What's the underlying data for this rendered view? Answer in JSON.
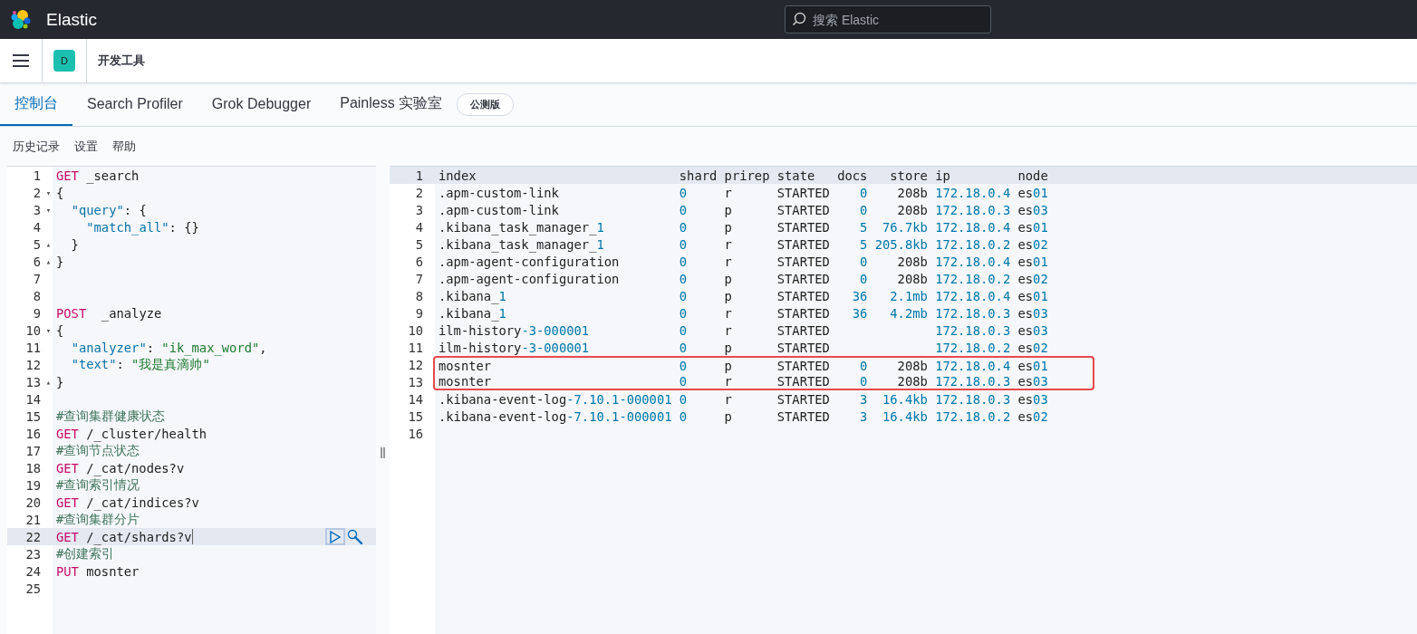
{
  "header": {
    "brand": "Elastic",
    "search": {
      "placeholder": "搜索 Elastic"
    }
  },
  "breadcrumb": {
    "space_initial": "D",
    "title": "开发工具"
  },
  "tabs": [
    {
      "label": "控制台",
      "selected": true
    },
    {
      "label": "Search Profiler",
      "selected": false
    },
    {
      "label": "Grok Debugger",
      "selected": false
    },
    {
      "label": "Painless 实验室",
      "selected": false,
      "badge": "公测版"
    }
  ],
  "menu": [
    "历史记录",
    "设置",
    "帮助"
  ],
  "editor": {
    "lines": [
      {
        "number": "1",
        "kind": "request",
        "text": "GET _search",
        "active": false
      },
      {
        "number": "2",
        "kind": "json",
        "text": "{",
        "fold_marker": "▾",
        "active": false
      },
      {
        "number": "3",
        "kind": "json",
        "text": "  \"query\": {",
        "fold_marker": "▾",
        "active": false
      },
      {
        "number": "4",
        "kind": "json",
        "text": "    \"match_all\": {}",
        "active": false
      },
      {
        "number": "5",
        "kind": "json",
        "text": "  }",
        "fold_marker": "▴",
        "active": false
      },
      {
        "number": "6",
        "kind": "json",
        "text": "}",
        "fold_marker": "▴",
        "active": false
      },
      {
        "number": "7",
        "kind": "blank",
        "active": false
      },
      {
        "number": "8",
        "kind": "blank",
        "active": false
      },
      {
        "number": "9",
        "kind": "request",
        "text": "POST  _analyze",
        "active": false
      },
      {
        "number": "10",
        "kind": "json",
        "text": "{",
        "fold_marker": "▾",
        "active": false
      },
      {
        "number": "11",
        "kind": "json",
        "text": "  \"analyzer\": \"ik_max_word\",",
        "active": false
      },
      {
        "number": "12",
        "kind": "json",
        "text": "  \"text\": \"我是真滴帅\"",
        "active": false
      },
      {
        "number": "13",
        "kind": "json",
        "text": "}",
        "fold_marker": "▴",
        "active": false
      },
      {
        "number": "14",
        "kind": "blank",
        "active": false
      },
      {
        "number": "15",
        "kind": "comment",
        "text": "#查询集群健康状态",
        "active": false
      },
      {
        "number": "16",
        "kind": "request",
        "text": "GET /_cluster/health",
        "active": false
      },
      {
        "number": "17",
        "kind": "comment",
        "text": "#查询节点状态",
        "active": false
      },
      {
        "number": "18",
        "kind": "request",
        "text": "GET /_cat/nodes?v",
        "active": false
      },
      {
        "number": "19",
        "kind": "comment",
        "text": "#查询索引情况",
        "active": false
      },
      {
        "number": "20",
        "kind": "request",
        "text": "GET /_cat/indices?v",
        "active": false
      },
      {
        "number": "21",
        "kind": "comment",
        "text": "#查询集群分片",
        "active": false
      },
      {
        "number": "22",
        "kind": "request",
        "text": "GET /_cat/shards?v",
        "active": true
      },
      {
        "number": "23",
        "kind": "comment",
        "text": "#创建索引",
        "active": false
      },
      {
        "number": "24",
        "kind": "request",
        "text": "PUT mosnter",
        "active": false
      },
      {
        "number": "25",
        "kind": "blank",
        "active": false
      }
    ]
  },
  "output": {
    "lines": [
      {
        "number": "1",
        "cells": [
          "index",
          "shard",
          "prirep",
          "state",
          "docs",
          "store",
          "ip",
          "node"
        ],
        "highlighted": false,
        "active": true
      },
      {
        "number": "2",
        "cells": [
          ".apm-custom-link",
          "0",
          "r",
          "STARTED",
          "0",
          "208b",
          "172.18.0.4",
          "es01"
        ],
        "highlighted": false,
        "active": false
      },
      {
        "number": "3",
        "cells": [
          ".apm-custom-link",
          "0",
          "p",
          "STARTED",
          "0",
          "208b",
          "172.18.0.3",
          "es03"
        ],
        "highlighted": false,
        "active": false
      },
      {
        "number": "4",
        "cells": [
          ".kibana_task_manager_1",
          "0",
          "p",
          "STARTED",
          "5",
          "76.7kb",
          "172.18.0.4",
          "es01"
        ],
        "highlighted": false,
        "active": false
      },
      {
        "number": "5",
        "cells": [
          ".kibana_task_manager_1",
          "0",
          "r",
          "STARTED",
          "5",
          "205.8kb",
          "172.18.0.2",
          "es02"
        ],
        "highlighted": false,
        "active": false
      },
      {
        "number": "6",
        "cells": [
          ".apm-agent-configuration",
          "0",
          "r",
          "STARTED",
          "0",
          "208b",
          "172.18.0.4",
          "es01"
        ],
        "highlighted": false,
        "active": false
      },
      {
        "number": "7",
        "cells": [
          ".apm-agent-configuration",
          "0",
          "p",
          "STARTED",
          "0",
          "208b",
          "172.18.0.2",
          "es02"
        ],
        "highlighted": false,
        "active": false
      },
      {
        "number": "8",
        "cells": [
          ".kibana_1",
          "0",
          "p",
          "STARTED",
          "36",
          "2.1mb",
          "172.18.0.4",
          "es01"
        ],
        "highlighted": false,
        "active": false
      },
      {
        "number": "9",
        "cells": [
          ".kibana_1",
          "0",
          "r",
          "STARTED",
          "36",
          "4.2mb",
          "172.18.0.3",
          "es03"
        ],
        "highlighted": false,
        "active": false
      },
      {
        "number": "10",
        "cells": [
          "ilm-history-3-000001",
          "0",
          "r",
          "STARTED",
          null,
          null,
          "172.18.0.3",
          "es03"
        ],
        "highlighted": false,
        "active": false
      },
      {
        "number": "11",
        "cells": [
          "ilm-history-3-000001",
          "0",
          "p",
          "STARTED",
          null,
          null,
          "172.18.0.2",
          "es02"
        ],
        "highlighted": false,
        "active": false
      },
      {
        "number": "12",
        "cells": [
          "mosnter",
          "0",
          "p",
          "STARTED",
          "0",
          "208b",
          "172.18.0.4",
          "es01"
        ],
        "highlighted": true,
        "active": false
      },
      {
        "number": "13",
        "cells": [
          "mosnter",
          "0",
          "r",
          "STARTED",
          "0",
          "208b",
          "172.18.0.3",
          "es03"
        ],
        "highlighted": true,
        "active": false
      },
      {
        "number": "14",
        "cells": [
          ".kibana-event-log-7.10.1-000001",
          "0",
          "r",
          "STARTED",
          "3",
          "16.4kb",
          "172.18.0.3",
          "es03"
        ],
        "highlighted": false,
        "active": false
      },
      {
        "number": "15",
        "cells": [
          ".kibana-event-log-7.10.1-000001",
          "0",
          "p",
          "STARTED",
          "3",
          "16.4kb",
          "172.18.0.2",
          "es02"
        ],
        "highlighted": false,
        "active": false
      },
      {
        "number": "16",
        "highlighted": false,
        "active": false
      }
    ]
  }
}
